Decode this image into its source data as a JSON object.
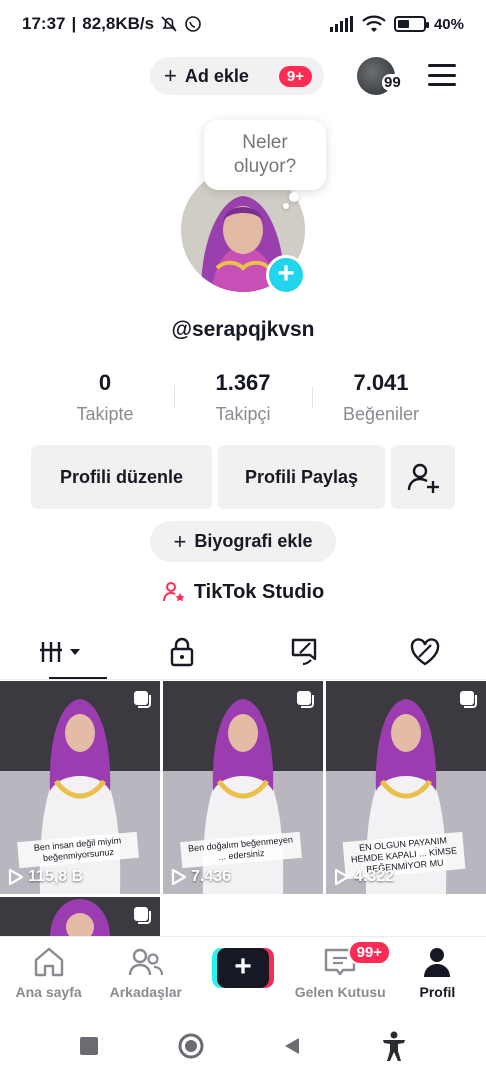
{
  "status_bar": {
    "time": "17:37",
    "network_speed": "82,8KB/s",
    "battery_percent": "40%",
    "battery_level": 0.4
  },
  "top_bar": {
    "add_account_label": "Ad ekle",
    "add_account_badge": "9+",
    "account_switch_count": "99"
  },
  "profile": {
    "status_bubble": "Neler oluyor?",
    "username": "@serapqjkvsn",
    "stats": [
      {
        "value": "0",
        "label": "Takipte"
      },
      {
        "value": "1.367",
        "label": "Takipçi"
      },
      {
        "value": "7.041",
        "label": "Beğeniler"
      }
    ],
    "edit_profile_label": "Profili düzenle",
    "share_profile_label": "Profili Paylaş",
    "add_bio_label": "Biyografi ekle",
    "studio_label": "TikTok Studio"
  },
  "tabs": [
    {
      "icon": "grid-icon",
      "active": true
    },
    {
      "icon": "lock-icon",
      "active": false
    },
    {
      "icon": "repost-icon",
      "active": false
    },
    {
      "icon": "liked-heart-icon",
      "active": false
    }
  ],
  "videos": [
    {
      "views": "115,8 B",
      "caption": "Ben insan değil miyim beğenmiyorsunuz"
    },
    {
      "views": "7.436",
      "caption": "Ben doğalım beğenmeyen ... edersiniz"
    },
    {
      "views": "4.322",
      "caption": "EN OLGUN PAYANIM HEMDE KAPALI ... KİMSE BEĞENMİYOR MU"
    },
    {
      "views": "",
      "caption": ""
    }
  ],
  "bottom_nav": {
    "home_label": "Ana sayfa",
    "friends_label": "Arkadaşlar",
    "inbox_label": "Gelen Kutusu",
    "inbox_badge": "99+",
    "profile_label": "Profil"
  },
  "colors": {
    "accent_pink": "#fe2c55",
    "accent_cyan": "#20d5ec",
    "text_primary": "#161823",
    "text_secondary": "#8a8b91"
  }
}
